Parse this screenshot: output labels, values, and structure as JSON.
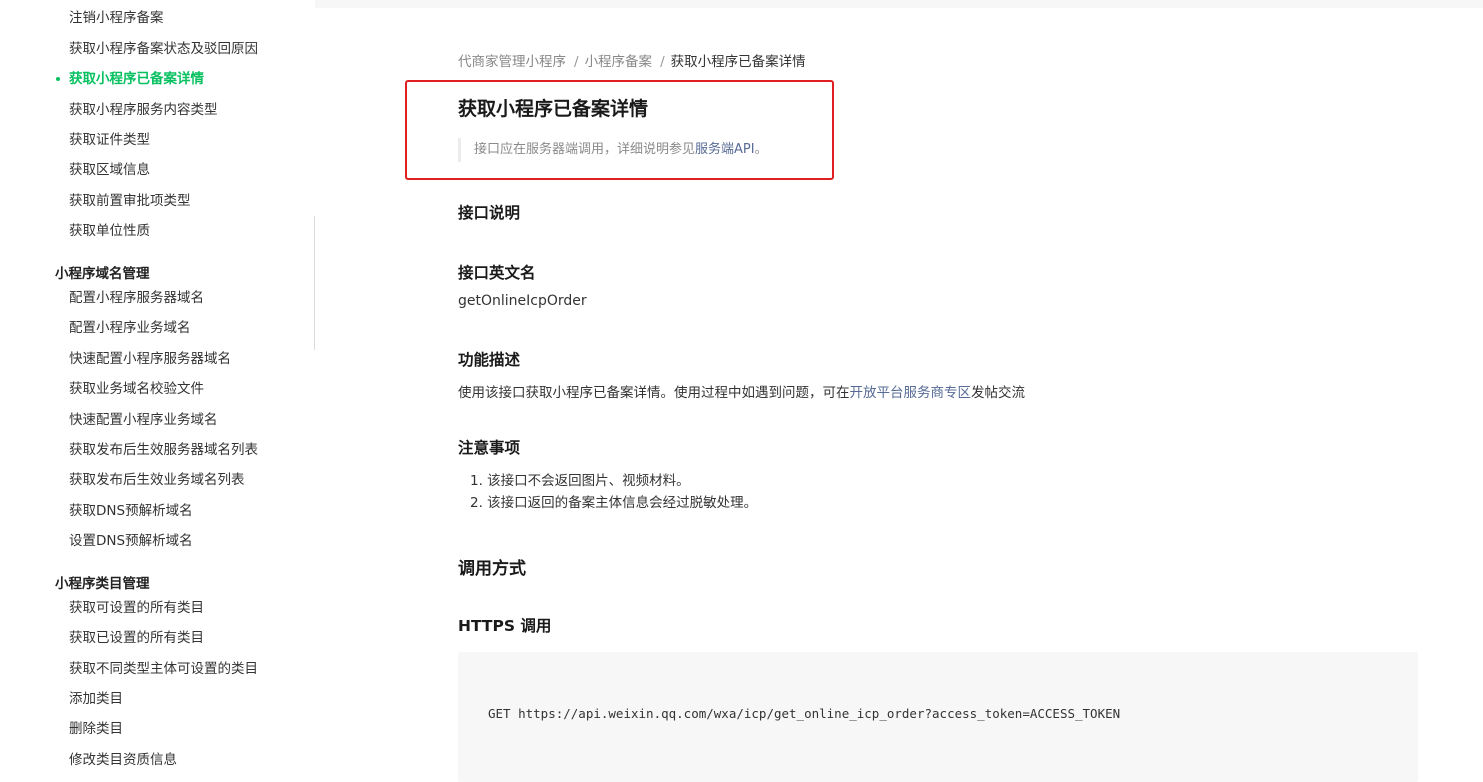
{
  "sidebar": {
    "items_top": [
      {
        "label": "注销小程序备案"
      },
      {
        "label": "获取小程序备案状态及驳回原因"
      },
      {
        "label": "获取小程序已备案详情",
        "active": true
      },
      {
        "label": "获取小程序服务内容类型"
      },
      {
        "label": "获取证件类型"
      },
      {
        "label": "获取区域信息"
      },
      {
        "label": "获取前置审批项类型"
      },
      {
        "label": "获取单位性质"
      }
    ],
    "group_domain": {
      "title": "小程序域名管理",
      "items": [
        "配置小程序服务器域名",
        "配置小程序业务域名",
        "快速配置小程序服务器域名",
        "获取业务域名校验文件",
        "快速配置小程序业务域名",
        "获取发布后生效服务器域名列表",
        "获取发布后生效业务域名列表",
        "获取DNS预解析域名",
        "设置DNS预解析域名"
      ]
    },
    "group_category": {
      "title": "小程序类目管理",
      "items": [
        "获取可设置的所有类目",
        "获取已设置的所有类目",
        "获取不同类型主体可设置的类目",
        "添加类目",
        "删除类目",
        "修改类目资质信息"
      ]
    }
  },
  "breadcrumb": {
    "items": [
      "代商家管理小程序",
      "小程序备案"
    ],
    "current": "获取小程序已备案详情",
    "separator": "/"
  },
  "page": {
    "title": "获取小程序已备案详情",
    "notice_prefix": "接口应在服务器端调用，详细说明参见",
    "notice_link": "服务端API",
    "notice_suffix": "。"
  },
  "sections": {
    "interface_desc": "接口说明",
    "english_name_title": "接口英文名",
    "english_name": "getOnlineIcpOrder",
    "function_title": "功能描述",
    "function_text_prefix": "使用该接口获取小程序已备案详情。使用过程中如遇到问题，可在",
    "function_link": "开放平台服务商专区",
    "function_text_suffix": "发帖交流",
    "notes_title": "注意事项",
    "notes": [
      "1. 该接口不会返回图片、视频材料。",
      "2. 该接口返回的备案主体信息会经过脱敏处理。"
    ],
    "call_method_title": "调用方式",
    "https_title": "HTTPS 调用",
    "code": "GET https://api.weixin.qq.com/wxa/icp/get_online_icp_order?access_token=ACCESS_TOKEN"
  },
  "colors": {
    "active": "#07c160",
    "link": "#576b95",
    "highlight_border": "#e02020"
  }
}
